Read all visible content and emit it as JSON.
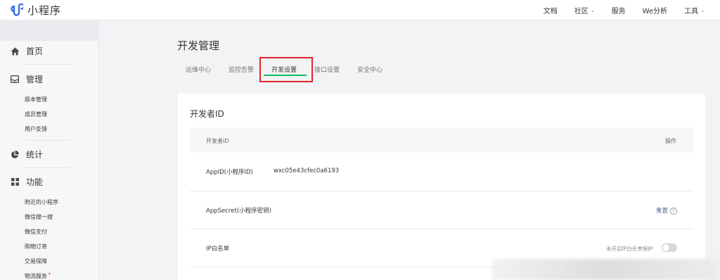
{
  "app": {
    "name": "小程序"
  },
  "topnav": [
    {
      "label": "文档",
      "dropdown": false
    },
    {
      "label": "社区",
      "dropdown": true
    },
    {
      "label": "服务",
      "dropdown": false
    },
    {
      "label": "We分析",
      "dropdown": false
    },
    {
      "label": "工具",
      "dropdown": true
    }
  ],
  "sidebar": {
    "home": {
      "label": "首页",
      "icon": "home-icon",
      "selected": true
    },
    "manage": {
      "label": "管理",
      "icon": "inbox-icon",
      "items": [
        "版本管理",
        "成员管理",
        "用户反馈"
      ]
    },
    "stats": {
      "label": "统计",
      "icon": "pie-chart-icon"
    },
    "features": {
      "label": "功能",
      "icon": "grid-icon",
      "items": [
        "附近的小程序",
        "微信搜一搜",
        "微信支付",
        "购物订单",
        "交易保障",
        "物流服务"
      ]
    }
  },
  "page": {
    "title": "开发管理"
  },
  "tabs": [
    "运维中心",
    "监控告警",
    "开发设置",
    "接口设置",
    "安全中心"
  ],
  "active_tab": "开发设置",
  "card": {
    "title": "开发者ID",
    "columns": {
      "id": "开发者ID",
      "action": "操作"
    },
    "rows": {
      "appid": {
        "label": "AppID(小程序ID)",
        "value": "wxc05e43cfec0a6193"
      },
      "secret": {
        "label": "AppSecret(小程序密钥)",
        "action": "重置"
      },
      "ip": {
        "label": "IP白名单",
        "status": "未开启IP白名单保护"
      }
    }
  },
  "colors": {
    "accent": "#07c160",
    "highlight_box": "#e0262b",
    "link": "#576b95"
  }
}
